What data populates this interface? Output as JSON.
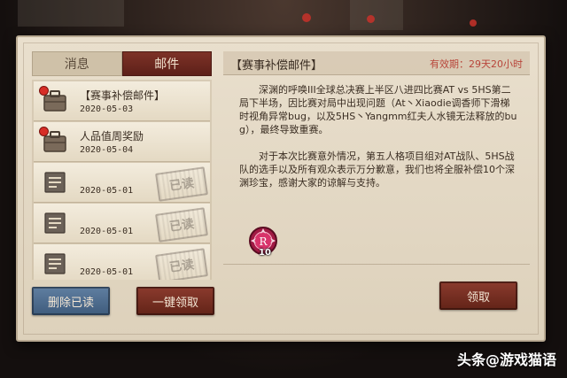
{
  "tabs": [
    {
      "label": "消息",
      "active": false
    },
    {
      "label": "邮件",
      "active": true
    }
  ],
  "mails": [
    {
      "title": "【赛事补偿邮件】",
      "date": "2020-05-03",
      "icon": "briefcase-icon",
      "unread": true,
      "read_stamp": ""
    },
    {
      "title": "人品值周奖励",
      "date": "2020-05-04",
      "icon": "briefcase-icon",
      "unread": true,
      "read_stamp": ""
    },
    {
      "title": "",
      "date": "2020-05-01",
      "icon": "document-icon",
      "unread": false,
      "read_stamp": "已读"
    },
    {
      "title": "",
      "date": "2020-05-01",
      "icon": "document-icon",
      "unread": false,
      "read_stamp": "已读"
    },
    {
      "title": "",
      "date": "2020-05-01",
      "icon": "document-icon",
      "unread": false,
      "read_stamp": "已读"
    }
  ],
  "buttons": {
    "delete_read": "删除已读",
    "claim_all": "一键领取",
    "claim": "领取"
  },
  "detail": {
    "title": "【赛事补偿邮件】",
    "expire": "有效期：29天20小时",
    "paragraphs": [
      "深渊的呼唤III全球总决赛上半区八进四比赛AT vs 5HS第二局下半场，因比赛对局中出现问题（At丶Xiaodie调香师下滑梯时视角异常bug，以及5HS丶Yangmm红夫人水镜无法释放的bug），最终导致重赛。",
      "对于本次比赛意外情况，第五人格项目组对AT战队、5HS战队的选手以及所有观众表示万分歉意，我们也将全服补偿10个深渊珍宝，感谢大家的谅解与支持。"
    ],
    "reward": {
      "icon": "abyss-treasure-icon",
      "count": "10"
    }
  },
  "watermark": "头条@游戏猫语",
  "colors": {
    "tab_active": "#6e2a20",
    "expire_text": "#b8453a",
    "unread_dot": "#d72d26",
    "delete_button": "#4f6d8f",
    "claim_button": "#7a3024"
  }
}
